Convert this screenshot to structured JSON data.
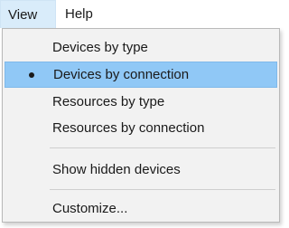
{
  "menubar": {
    "items": [
      {
        "label": "View"
      },
      {
        "label": "Help"
      }
    ]
  },
  "view_menu": {
    "items": [
      {
        "label": "Devices by type",
        "checked": false
      },
      {
        "label": "Devices by connection",
        "checked": true
      },
      {
        "label": "Resources by type",
        "checked": false
      },
      {
        "label": "Resources by connection",
        "checked": false
      },
      {
        "label": "Show hidden devices",
        "checked": false
      },
      {
        "label": "Customize...",
        "checked": false
      }
    ]
  },
  "colors": {
    "selected_item_bg": "#90c8f6",
    "menubar_active_bg": "#d9ecfa",
    "menu_bg": "#f2f2f2"
  }
}
